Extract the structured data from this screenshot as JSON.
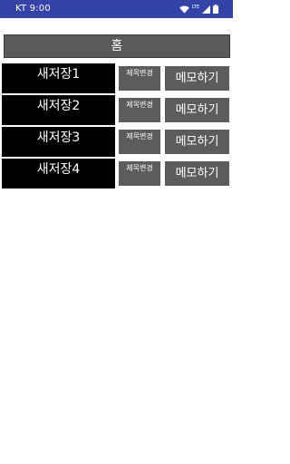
{
  "status_bar": {
    "carrier_time": "KT 9:00",
    "network_label": "LTE",
    "icons": [
      "wifi-icon",
      "lte-icon",
      "signal-icon",
      "battery-icon"
    ],
    "color": "#3444a6"
  },
  "home_button": {
    "label": "홈"
  },
  "rows": [
    {
      "title": "새저장1",
      "rename_label": "제목변경",
      "memo_label": "메모하기"
    },
    {
      "title": "새저장2",
      "rename_label": "제목변경",
      "memo_label": "메모하기"
    },
    {
      "title": "새저장3",
      "rename_label": "제목변경",
      "memo_label": "메모하기"
    },
    {
      "title": "새저장4",
      "rename_label": "제목변경",
      "memo_label": "메모하기"
    }
  ],
  "colors": {
    "title_background": "#000000",
    "button_background": "#5c5c5c",
    "text": "#ffffff"
  }
}
